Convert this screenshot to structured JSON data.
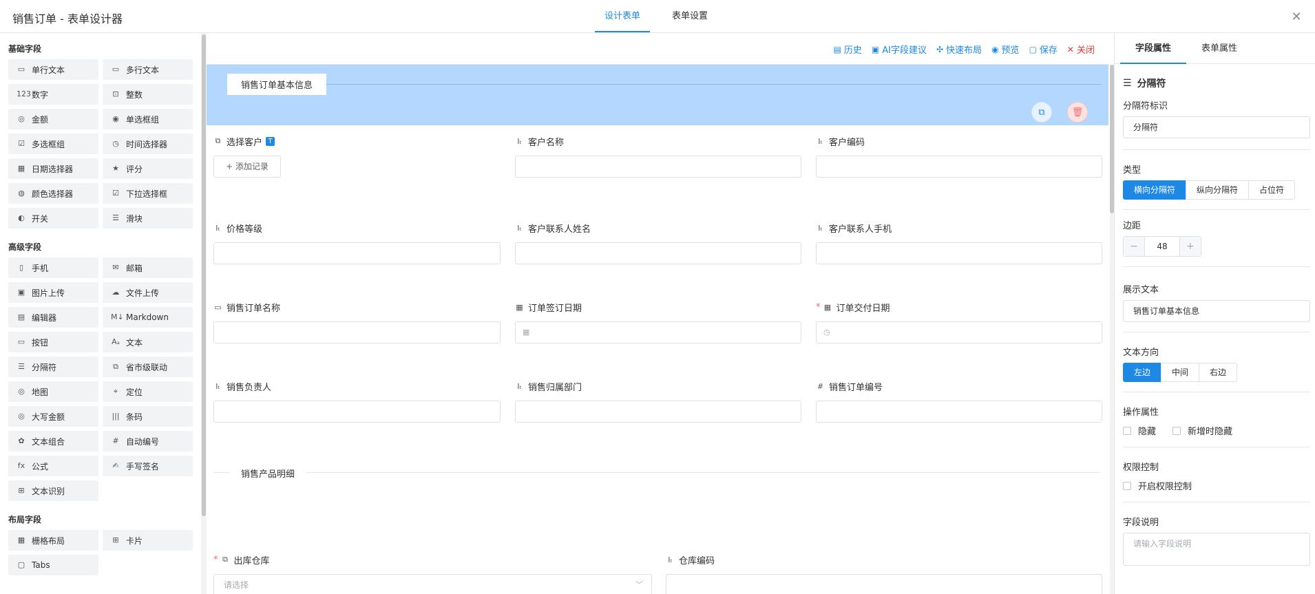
{
  "app": {
    "title": "销售订单 - 表单设计器",
    "tabs": [
      "设计表单",
      "表单设置"
    ],
    "close": "✕"
  },
  "left": {
    "groups": [
      {
        "title": "基础字段",
        "items": [
          {
            "label": "单行文本",
            "icon": "▭"
          },
          {
            "label": "多行文本",
            "icon": "▭"
          },
          {
            "label": "数字",
            "icon": "123"
          },
          {
            "label": "整数",
            "icon": "⊡"
          },
          {
            "label": "金额",
            "icon": "◎"
          },
          {
            "label": "单选框组",
            "icon": "◉"
          },
          {
            "label": "多选框组",
            "icon": "☑"
          },
          {
            "label": "时间选择器",
            "icon": "◷"
          },
          {
            "label": "日期选择器",
            "icon": "▦"
          },
          {
            "label": "评分",
            "icon": "★"
          },
          {
            "label": "颜色选择器",
            "icon": "◍"
          },
          {
            "label": "下拉选择框",
            "icon": "☑"
          },
          {
            "label": "开关",
            "icon": "◐"
          },
          {
            "label": "滑块",
            "icon": "☰"
          }
        ]
      },
      {
        "title": "高级字段",
        "items": [
          {
            "label": "手机",
            "icon": "▯"
          },
          {
            "label": "邮箱",
            "icon": "✉"
          },
          {
            "label": "图片上传",
            "icon": "▣"
          },
          {
            "label": "文件上传",
            "icon": "☁"
          },
          {
            "label": "编辑器",
            "icon": "▤"
          },
          {
            "label": "Markdown",
            "icon": "M↓"
          },
          {
            "label": "按钮",
            "icon": "▭"
          },
          {
            "label": "文本",
            "icon": "Aₐ"
          },
          {
            "label": "分隔符",
            "icon": "☰"
          },
          {
            "label": "省市级联动",
            "icon": "⧉"
          },
          {
            "label": "地图",
            "icon": "◎"
          },
          {
            "label": "定位",
            "icon": "⌖"
          },
          {
            "label": "大写金额",
            "icon": "◎"
          },
          {
            "label": "条码",
            "icon": "|||"
          },
          {
            "label": "文本组合",
            "icon": "✿"
          },
          {
            "label": "自动编号",
            "icon": "#"
          },
          {
            "label": "公式",
            "icon": "fx"
          },
          {
            "label": "手写签名",
            "icon": "✍"
          },
          {
            "label": "文本识别",
            "icon": "⊞"
          }
        ]
      },
      {
        "title": "布局字段",
        "items": [
          {
            "label": "栅格布局",
            "icon": "▦"
          },
          {
            "label": "卡片",
            "icon": "⊞"
          },
          {
            "label": "Tabs",
            "icon": "▢"
          }
        ]
      }
    ]
  },
  "toolbar": {
    "items": [
      {
        "label": "历史",
        "icon": "▤"
      },
      {
        "label": "AI字段建议",
        "icon": "▣"
      },
      {
        "label": "快速布局",
        "icon": "✣"
      },
      {
        "label": "预览",
        "icon": "◉"
      },
      {
        "label": "保存",
        "icon": "▢"
      },
      {
        "label": "关闭",
        "icon": "✕"
      }
    ]
  },
  "canvas": {
    "section1": "销售订单基本信息",
    "section2": "销售产品明细",
    "add_record": "+ 添加记录",
    "fields": {
      "f1": {
        "label": "选择客户",
        "badge": "T"
      },
      "f2": {
        "label": "客户名称"
      },
      "f3": {
        "label": "客户编码"
      },
      "f4": {
        "label": "价格等级"
      },
      "f5": {
        "label": "客户联系人姓名"
      },
      "f6": {
        "label": "客户联系人手机"
      },
      "f7": {
        "label": "销售订单名称"
      },
      "f8": {
        "label": "订单签订日期"
      },
      "f9": {
        "label": "订单交付日期",
        "required": "*"
      },
      "f10": {
        "label": "销售负责人"
      },
      "f11": {
        "label": "销售归属部门"
      },
      "f12": {
        "label": "销售订单编号"
      },
      "f13": {
        "label": "出库仓库",
        "required": "*",
        "placeholder": "请选择"
      },
      "f14": {
        "label": "仓库编码"
      }
    }
  },
  "right": {
    "tabs": [
      "字段属性",
      "表单属性"
    ],
    "header": "分隔符",
    "id_label": "分隔符标识",
    "id_value": "分隔符",
    "type_label": "类型",
    "type_options": [
      "横向分隔符",
      "纵向分隔符",
      "占位符"
    ],
    "type_selected": "横向分隔符",
    "margin_label": "边距",
    "margin_value": "48",
    "minus": "−",
    "plus": "+",
    "text_label": "展示文本",
    "text_value": "销售订单基本信息",
    "dir_label": "文本方向",
    "dir_options": [
      "左边",
      "中间",
      "右边"
    ],
    "dir_selected": "左边",
    "ops_label": "操作属性",
    "ops": [
      "隐藏",
      "新增时隐藏"
    ],
    "perm_label": "权限控制",
    "perm": "开启权限控制",
    "desc_label": "字段说明",
    "desc_placeholder": "请输入字段说明"
  },
  "colors": {
    "accent": "#1e88e5",
    "band": "#b3d7ff",
    "danger": "#f56c6c"
  }
}
